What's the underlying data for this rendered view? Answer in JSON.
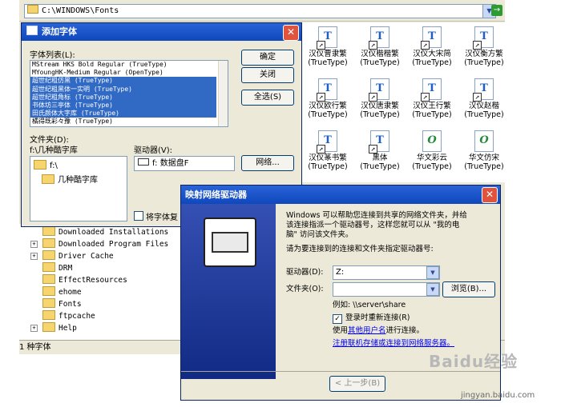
{
  "explorer": {
    "address": "C:\\WINDOWS\\Fonts",
    "go_arrow": "→",
    "status_text": "1 种字体"
  },
  "font_icons": [
    {
      "name": "汉仪曹隶繁",
      "type": "(TrueType)",
      "glyph": "T"
    },
    {
      "name": "汉仪楷楷繁",
      "type": "(TrueType)",
      "glyph": "T"
    },
    {
      "name": "汉仪大宋简",
      "type": "(TrueType)",
      "glyph": "T"
    },
    {
      "name": "汉仪衡方繁",
      "type": "(TrueType)",
      "glyph": "T"
    },
    {
      "name": "汉仪欧行繁",
      "type": "(TrueType)",
      "glyph": "T"
    },
    {
      "name": "汉仪唐隶繁",
      "type": "(TrueType)",
      "glyph": "T"
    },
    {
      "name": "汉仪王行繁",
      "type": "(TrueType)",
      "glyph": "T"
    },
    {
      "name": "汉仪赵楷",
      "type": "(TrueType)",
      "glyph": "T"
    },
    {
      "name": "汉仪篆书繁",
      "type": "(TrueType)",
      "glyph": "T"
    },
    {
      "name": "黑体",
      "type": "(TrueType)",
      "glyph": "T"
    },
    {
      "name": "华文彩云",
      "type": "(TrueType)",
      "glyph": "O"
    },
    {
      "name": "华文仿宋",
      "type": "(TrueType)",
      "glyph": "O"
    }
  ],
  "tree": [
    {
      "label": "Downloaded Installations",
      "expander": false
    },
    {
      "label": "Downloaded Program Files",
      "expander": true
    },
    {
      "label": "Driver Cache",
      "expander": true
    },
    {
      "label": "DRM",
      "expander": false
    },
    {
      "label": "EffectResources",
      "expander": false
    },
    {
      "label": "ehome",
      "expander": false
    },
    {
      "label": "Fonts",
      "expander": false
    },
    {
      "label": "ftpcache",
      "expander": false
    },
    {
      "label": "Help",
      "expander": true
    }
  ],
  "add_font": {
    "title": "添加字体",
    "close": "✕",
    "list_label": "字体列表(L):",
    "list": [
      {
        "text": "MStream HKS Bold Regular (TrueType)",
        "selected": false
      },
      {
        "text": "MYoungHK-Medium Regular (OpenType)",
        "selected": false
      },
      {
        "text": "超世纪粗仿黑 (TrueType)",
        "selected": true
      },
      {
        "text": "超世纪粗黑体一实明 (TrueType)",
        "selected": true
      },
      {
        "text": "超世纪粗角标 (TrueType)",
        "selected": true
      },
      {
        "text": "书体坊三亭体 (TrueType)",
        "selected": true
      },
      {
        "text": "田氏颜体大字库 (TrueType)",
        "selected": true
      },
      {
        "text": "橘得既彩々豫 (TrueType)",
        "selected": false
      }
    ],
    "btn_ok": "确定",
    "btn_close": "关闭",
    "btn_select_all": "全选(S)",
    "folder_label": "文件夹(D):",
    "folder_path": "f:\\几种酷字库",
    "folder_items": [
      "f:\\",
      "几种酷字库"
    ],
    "drive_label": "驱动器(V):",
    "drive_value": "f: 数据盘F",
    "btn_network": "网络...",
    "copy_checkbox": "将字体复"
  },
  "map_drive": {
    "title": "映射网络驱动器",
    "close": "✕",
    "intro": [
      "Windows 可以帮助您连接到共享的网络文件夹，并给",
      "该连接指派一个驱动器号，这样您就可以从 \"我的电",
      "脑\" 访问该文件夹。"
    ],
    "instruction": "请为要连接到的连接和文件夹指定驱动器号:",
    "drive_label": "驱动器(D):",
    "drive_value": "Z:",
    "folder_label": "文件夹(O):",
    "folder_value": "",
    "browse": "浏览(B)...",
    "example": "例如: \\\\server\\share",
    "reconnect_check": "✓",
    "reconnect_label": "登录时重新连接(R)",
    "other_user_prefix": "使用",
    "other_user_link": "其他用户名",
    "other_user_suffix": "进行连接。",
    "register_link": "注册联机存储或连接到网络服务器。",
    "back": "< 上一步(B)"
  },
  "watermark": {
    "text": "Baidu经验",
    "sub": "jingyan.baidu.com"
  }
}
